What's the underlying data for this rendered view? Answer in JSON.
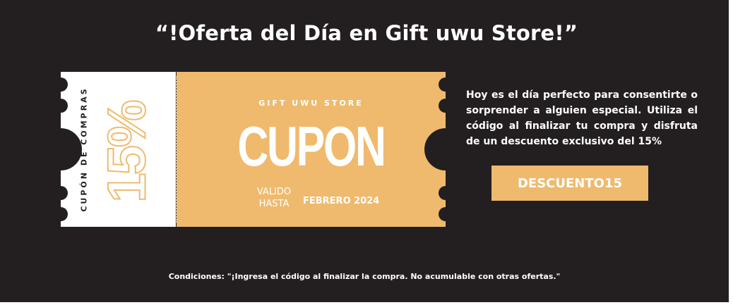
{
  "banner": {
    "title": "“!Oferta del Día en Gift uwu Store!”",
    "colors": {
      "background": "#231f20",
      "accent": "#efba6d",
      "text": "#ffffff"
    }
  },
  "coupon": {
    "vertical_label": "CUPÓN DE COMPRAS",
    "percentage": "15%",
    "store_name": "GIFT UWU STORE",
    "heading": "CUPON",
    "valid_label_line1": "VALIDO",
    "valid_label_line2": "HASTA",
    "valid_date": "FEBRERO 2024"
  },
  "description": "Hoy es el día perfecto para consentirte o sorprender a alguien especial. Utiliza el código al finalizar tu compra y disfruta de un descuento exclusivo del 15%",
  "code_button": {
    "label": "DESCUENTO15"
  },
  "conditions": "Condiciones: \"¡Ingresa el código al finalizar la compra. No acumulable con otras ofertas.\""
}
